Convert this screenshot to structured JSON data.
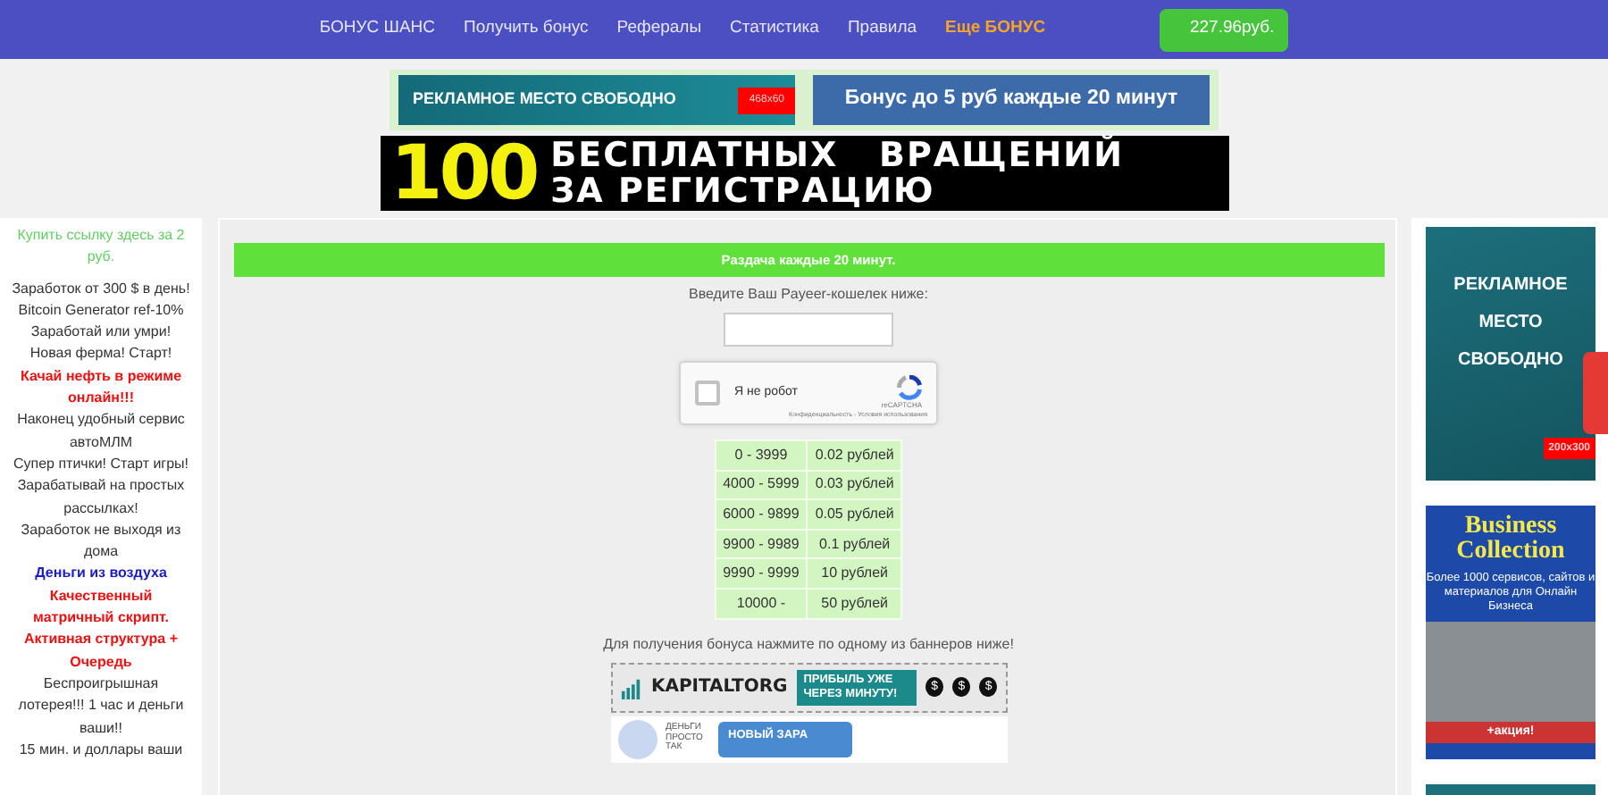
{
  "nav": {
    "items": [
      {
        "label": "БОНУС ШАНС",
        "highlight": false
      },
      {
        "label": "Получить бонус",
        "highlight": false
      },
      {
        "label": "Рефералы",
        "highlight": false
      },
      {
        "label": "Статистика",
        "highlight": false
      },
      {
        "label": "Правила",
        "highlight": false
      },
      {
        "label": "Еще БОНУС",
        "highlight": true
      }
    ],
    "balance": "227.96руб."
  },
  "top_banners": [
    {
      "kind": "free",
      "text": "РЕКЛАМНОЕ  МЕСТО СВОБОДНО",
      "tag": "468x60"
    },
    {
      "kind": "promo",
      "text": "Бонус до 5 руб каждые 20 минут"
    }
  ],
  "wide_banner": {
    "number": "100",
    "line_1": "БЕСПЛАТНЫХ   ВРАЩЕНИЙ",
    "line_2": "ЗА РЕГИСТРАЦИЮ"
  },
  "left_links": [
    {
      "text": "Купить ссылку здесь за 2 руб.",
      "color": "#66cc66",
      "bold": false
    },
    {
      "text": "Заработок от 300 $ в день!",
      "color": "#333333",
      "bold": false
    },
    {
      "text": "Bitcoin Generator ref-10%",
      "color": "#333333",
      "bold": false
    },
    {
      "text": "Заработай или умри!",
      "color": "#333333",
      "bold": false
    },
    {
      "text": "Новая ферма! Старт!",
      "color": "#333333",
      "bold": false
    },
    {
      "text": "Качай нефть в режиме онлайн!!!",
      "color": "#ee1111",
      "bold": true
    },
    {
      "text": "Наконец удобный сервис автоМЛМ",
      "color": "#333333",
      "bold": false
    },
    {
      "text": "Супер птички! Старт игры!",
      "color": "#333333",
      "bold": false
    },
    {
      "text": "Зарабатывай на простых рассылках!",
      "color": "#333333",
      "bold": false
    },
    {
      "text": "Заработок не выходя из дома",
      "color": "#333333",
      "bold": false
    },
    {
      "text": "Деньги из воздуха",
      "color": "#1a1acc",
      "bold": true
    },
    {
      "text": "Качественный матричный скрипт.",
      "color": "#ee1111",
      "bold": true
    },
    {
      "text": "Активная структура + Очередь",
      "color": "#ee1111",
      "bold": true
    },
    {
      "text": "Беспроигрышная лотерея!!! 1 час и деньги ваши!!",
      "color": "#333333",
      "bold": false
    },
    {
      "text": "15 мин. и доллары ваши",
      "color": "#333333",
      "bold": false
    }
  ],
  "main": {
    "header": "Раздача каждые 20 минут.",
    "wallet_label": "Введите Ваш Payeer-кошелек ниже:",
    "captcha": {
      "checked": false,
      "label": "Я не робот",
      "brand": "reCAPTCHA",
      "links": "Конфиденциальность - Условия использования"
    },
    "rates": [
      [
        "0 - 3999",
        "0.02 рублей"
      ],
      [
        "4000 - 5999",
        "0.03 рублей"
      ],
      [
        "6000 - 9899",
        "0.05 рублей"
      ],
      [
        "9900 - 9989",
        "0.1 рублей"
      ],
      [
        "9990 - 9999",
        "10 рублей"
      ],
      [
        "10000 -",
        "50 рублей"
      ]
    ],
    "banner_hint": "Для получения бонуса нажмите по одному из баннеров ниже!",
    "banners": [
      {
        "kind": "kapital",
        "brand": "KAPITALTORG",
        "slogan": "ПРИБЫЛЬ УЖЕ ЧЕРЕЗ МИНУТУ!",
        "coins": [
          "$",
          "$",
          "$"
        ]
      },
      {
        "kind": "money",
        "side": "ДЕНЬГИ ПРОСТО ТАК",
        "slogan": "НОВЫЙ ЗАРА"
      }
    ]
  },
  "right_ads": [
    {
      "kind": "free",
      "text": "РЕКЛАМНОЕ МЕСТО СВОБОДНО",
      "tag": "200x300"
    },
    {
      "kind": "business",
      "title": "Business Collection",
      "text": "Более 1000 сервисов, сайтов и материалов для Онлайн Бизнеса",
      "action": "+акция!"
    },
    {
      "kind": "plain"
    }
  ]
}
